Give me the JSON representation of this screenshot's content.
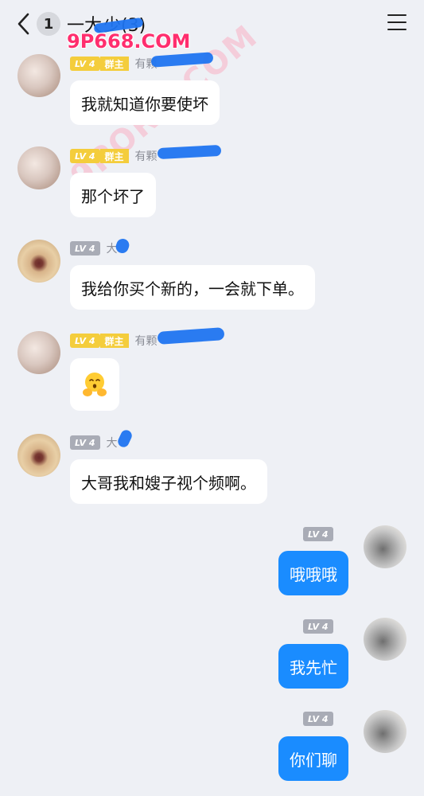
{
  "header": {
    "unread_count": "1",
    "title": "一大",
    "title_suffix": "少(3)"
  },
  "watermark": {
    "top": "9P668.COM",
    "diagonal": "9PORN.COM"
  },
  "messages": [
    {
      "side": "left",
      "level": "LV 4",
      "role": "群主",
      "nick": "有颗",
      "text": "我就知道你要使坏",
      "avatar": "girl"
    },
    {
      "side": "left",
      "level": "LV 4",
      "role": "群主",
      "nick": "有颗",
      "text": "那个坏了",
      "avatar": "girl"
    },
    {
      "side": "left",
      "level": "LV 4",
      "role": "",
      "nick": "大",
      "text": "我给你买个新的，一会就下单。",
      "avatar": "cat-yawn"
    },
    {
      "side": "left",
      "level": "LV 4",
      "role": "群主",
      "nick": "有颗",
      "text": "",
      "emoji": "hugging-face",
      "avatar": "girl"
    },
    {
      "side": "left",
      "level": "LV 4",
      "role": "",
      "nick": "大",
      "text": "大哥我和嫂子视个频啊。",
      "avatar": "cat-yawn"
    },
    {
      "side": "right",
      "level": "LV 4",
      "text": "哦哦哦",
      "avatar": "tabby"
    },
    {
      "side": "right",
      "level": "LV 4",
      "text": "我先忙",
      "avatar": "tabby"
    },
    {
      "side": "right",
      "level": "LV 4",
      "text": "你们聊",
      "avatar": "tabby"
    }
  ],
  "colors": {
    "background": "#eef0f5",
    "bubble_mine": "#1a8cff",
    "badge_gold": "#f4cd3c",
    "badge_gray": "#a9acb6"
  }
}
